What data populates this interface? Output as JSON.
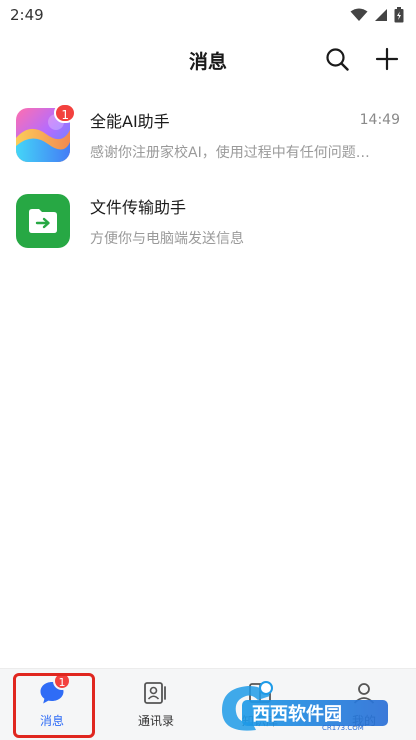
{
  "status_bar": {
    "time": "2:49"
  },
  "header": {
    "title": "消息"
  },
  "conversations": [
    {
      "name": "全能AI助手",
      "time": "14:49",
      "preview": "感谢你注册家校AI，使用过程中有任何问题…",
      "badge": "1",
      "avatar": "ai-gradient-avatar"
    },
    {
      "name": "文件传输助手",
      "time": "",
      "preview": "方便你与电脑端发送信息",
      "badge": "",
      "avatar": "folder-arrow-icon"
    }
  ],
  "tabs": [
    {
      "label": "消息",
      "badge": "1",
      "icon": "chat-bubble-icon",
      "active": true
    },
    {
      "label": "通讯录",
      "icon": "contacts-icon"
    },
    {
      "label": "知识库",
      "icon": "knowledge-icon"
    },
    {
      "label": "我的",
      "icon": "profile-icon"
    }
  ],
  "watermark": {
    "text": "西西软件园",
    "sub": "CR173.COM"
  },
  "colors": {
    "accent": "#2f6cf6",
    "badge": "#f3413e",
    "file_green": "#27a844",
    "highlight": "#e0261f"
  }
}
